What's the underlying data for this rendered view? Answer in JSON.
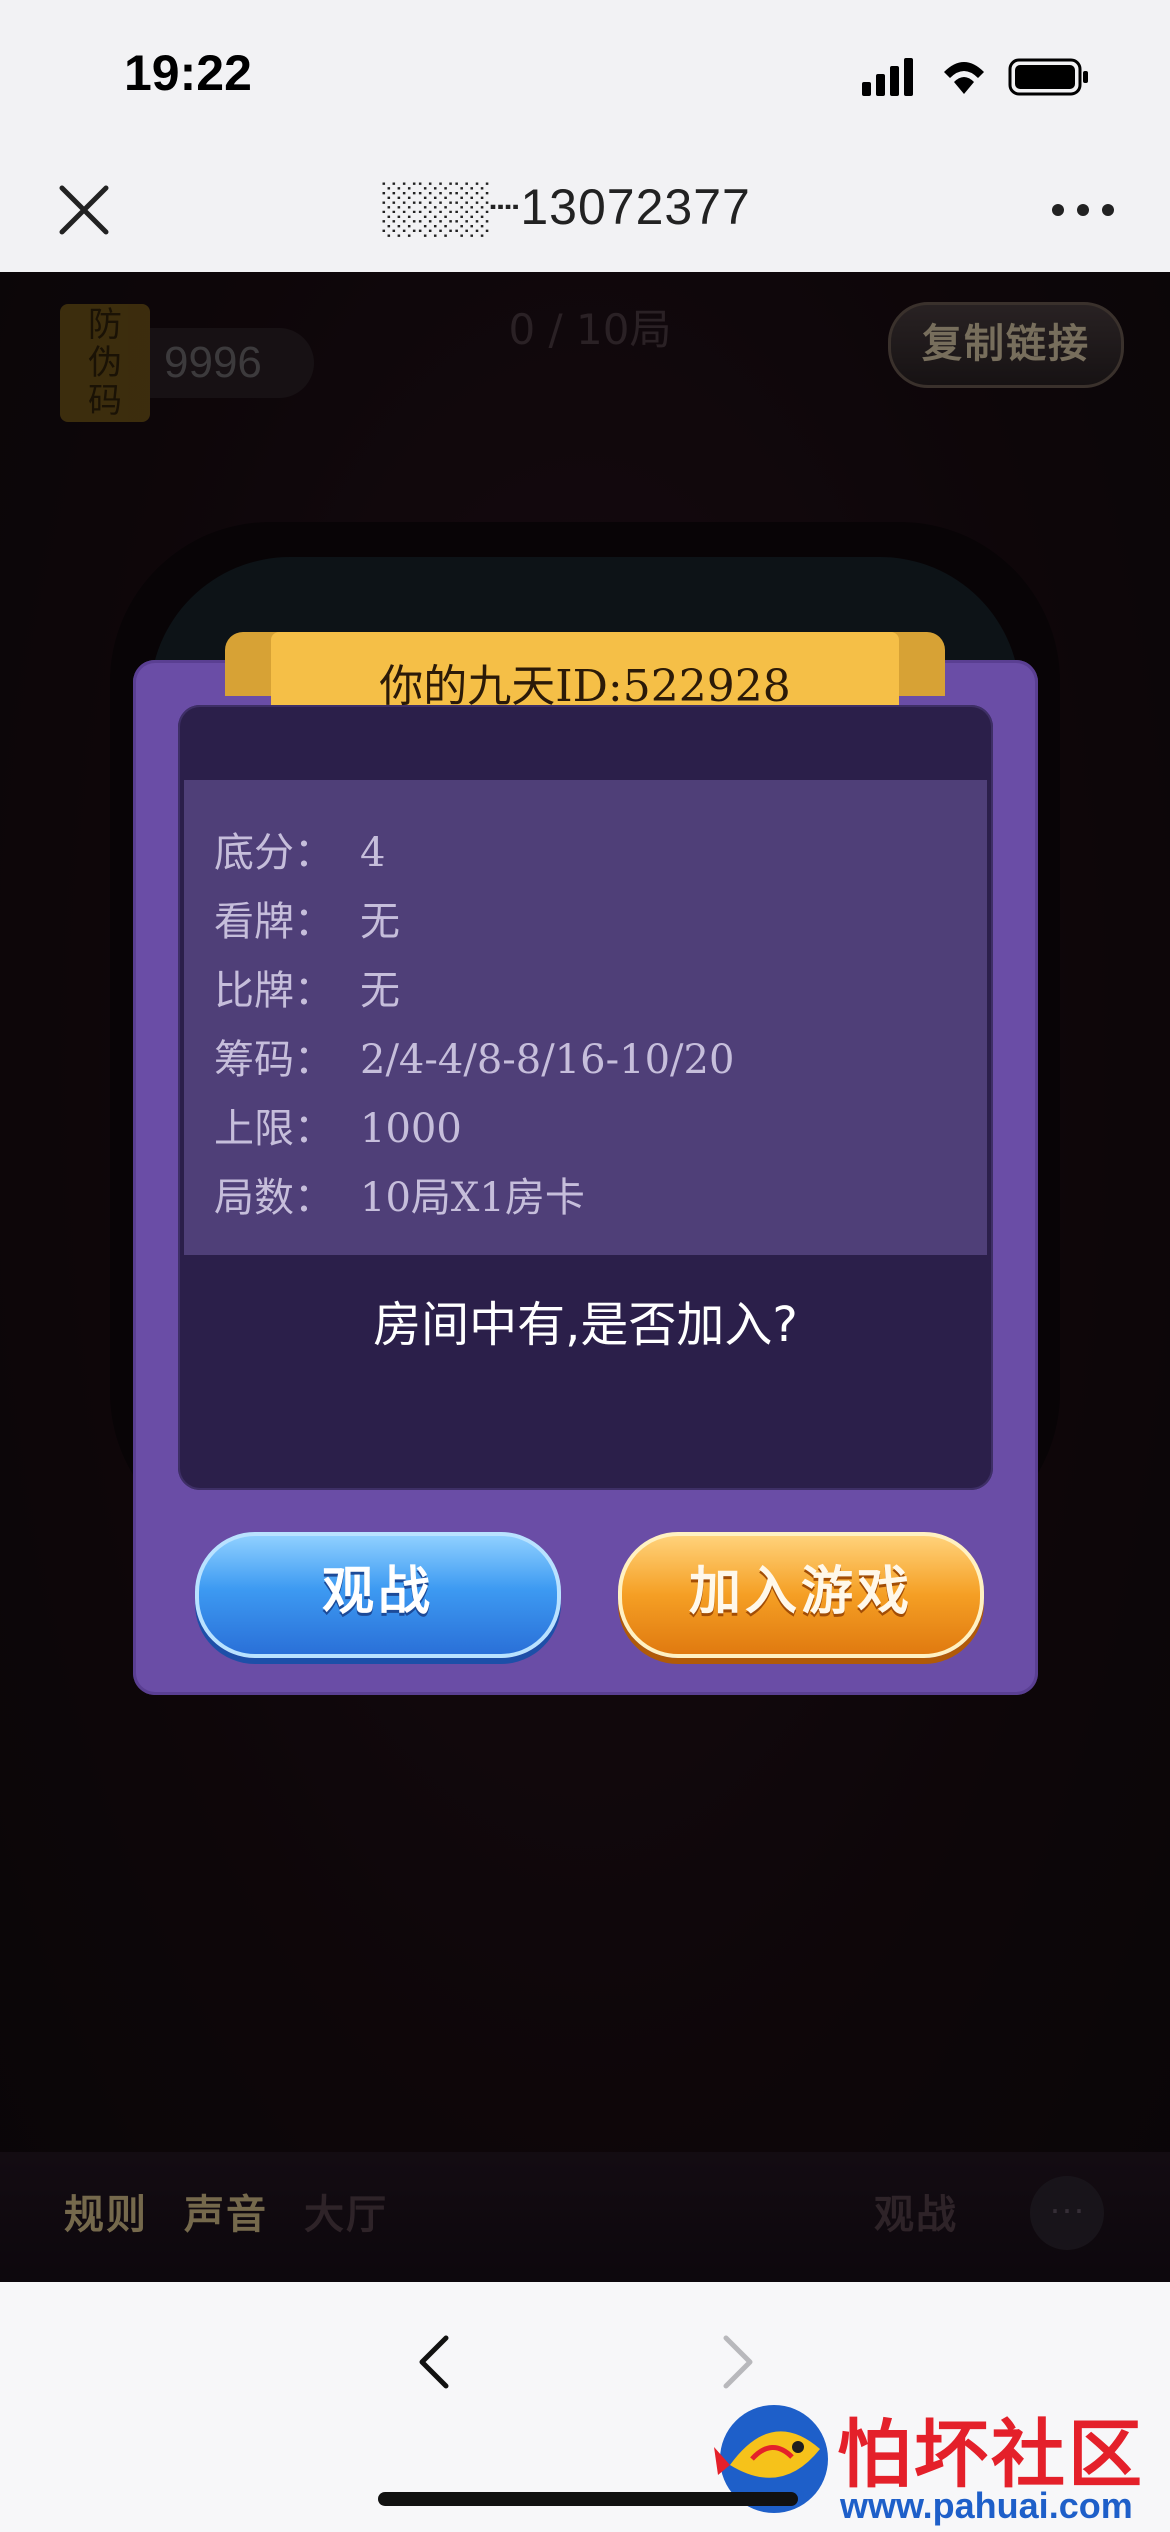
{
  "status_bar": {
    "time": "19:22"
  },
  "nav": {
    "title": "░░░┈13072377"
  },
  "game": {
    "anti_fake_label": "防\n伪\n码",
    "anti_fake_code": "9996",
    "round_count": "0 / 10局",
    "copy_link_label": "复制链接",
    "bottom": {
      "rules": "规则",
      "sound": "声音",
      "lobby": "大厅",
      "watch": "观战",
      "chat_icon": "···"
    }
  },
  "dialog": {
    "title": "你的九天ID:522928",
    "rows": [
      {
        "key": "底分：",
        "value": "4"
      },
      {
        "key": "看牌：",
        "value": "无"
      },
      {
        "key": "比牌：",
        "value": "无"
      },
      {
        "key": "筹码：",
        "value": "2/4-4/8-8/16-10/20"
      },
      {
        "key": "上限：",
        "value": "1000"
      },
      {
        "key": "局数：",
        "value": "10局X1房卡"
      }
    ],
    "question": "房间中有,是否加入?",
    "watch_button": "观战",
    "join_button": "加入游戏"
  },
  "watermark": {
    "title": "怕坏社区",
    "url": "www.pahuai.com"
  },
  "colors": {
    "dialog_bg": "#6a4da6",
    "ribbon": "#f5bf47",
    "watch_btn": "#3d9af2",
    "join_btn": "#f59f24"
  }
}
